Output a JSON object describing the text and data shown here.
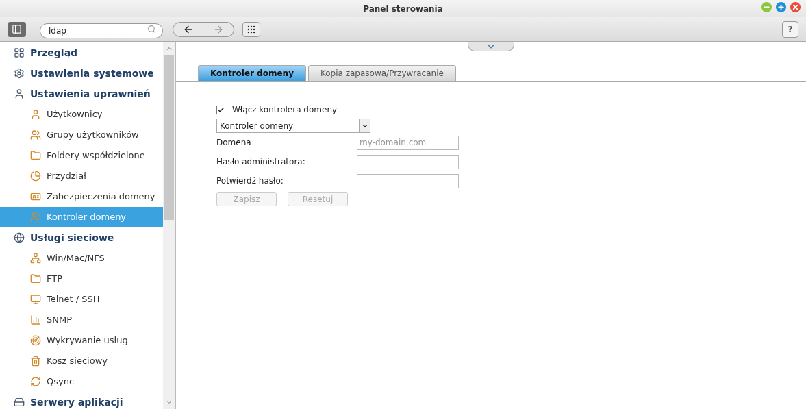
{
  "window": {
    "title": "Panel sterowania"
  },
  "toolbar": {
    "search": {
      "value": "ldap"
    },
    "help": "?"
  },
  "sidebar": {
    "items": [
      {
        "kind": "section",
        "label": "Przegląd",
        "selected": false
      },
      {
        "kind": "section",
        "label": "Ustawienia systemowe",
        "selected": false
      },
      {
        "kind": "section",
        "label": "Ustawienia uprawnień",
        "selected": false,
        "children": [
          {
            "kind": "item",
            "label": "Użytkownicy",
            "selected": false
          },
          {
            "kind": "item",
            "label": "Grupy użytkowników",
            "selected": false
          },
          {
            "kind": "item",
            "label": "Foldery współdzielone",
            "selected": false
          },
          {
            "kind": "item",
            "label": "Przydział",
            "selected": false
          },
          {
            "kind": "item",
            "label": "Zabezpieczenia domeny",
            "selected": false
          },
          {
            "kind": "item",
            "label": "Kontroler domeny",
            "selected": true
          }
        ]
      },
      {
        "kind": "section",
        "label": "Usługi sieciowe",
        "selected": false,
        "children": [
          {
            "kind": "item",
            "label": "Win/Mac/NFS",
            "selected": false
          },
          {
            "kind": "item",
            "label": "FTP",
            "selected": false
          },
          {
            "kind": "item",
            "label": "Telnet / SSH",
            "selected": false
          },
          {
            "kind": "item",
            "label": "SNMP",
            "selected": false
          },
          {
            "kind": "item",
            "label": "Wykrywanie usług",
            "selected": false
          },
          {
            "kind": "item",
            "label": "Kosz sieciowy",
            "selected": false
          },
          {
            "kind": "item",
            "label": "Qsync",
            "selected": false
          }
        ]
      },
      {
        "kind": "section",
        "label": "Serwery aplikacji",
        "selected": false
      }
    ]
  },
  "tabs": [
    {
      "label": "Kontroler domeny",
      "selected": true
    },
    {
      "label": "Kopia zapasowa/Przywracanie",
      "selected": false
    }
  ],
  "form": {
    "enable": {
      "label": "Włącz kontrolera domeny",
      "checked": true
    },
    "mode": {
      "value": "Kontroler domeny"
    },
    "fields": [
      {
        "label": "Domena",
        "placeholder": "my-domain.com"
      },
      {
        "label": "Hasło administratora:"
      },
      {
        "label": "Potwierdź hasło:"
      }
    ],
    "buttons": [
      {
        "label": "Zapisz",
        "disabled": true
      },
      {
        "label": "Resetuj",
        "disabled": true
      }
    ]
  }
}
